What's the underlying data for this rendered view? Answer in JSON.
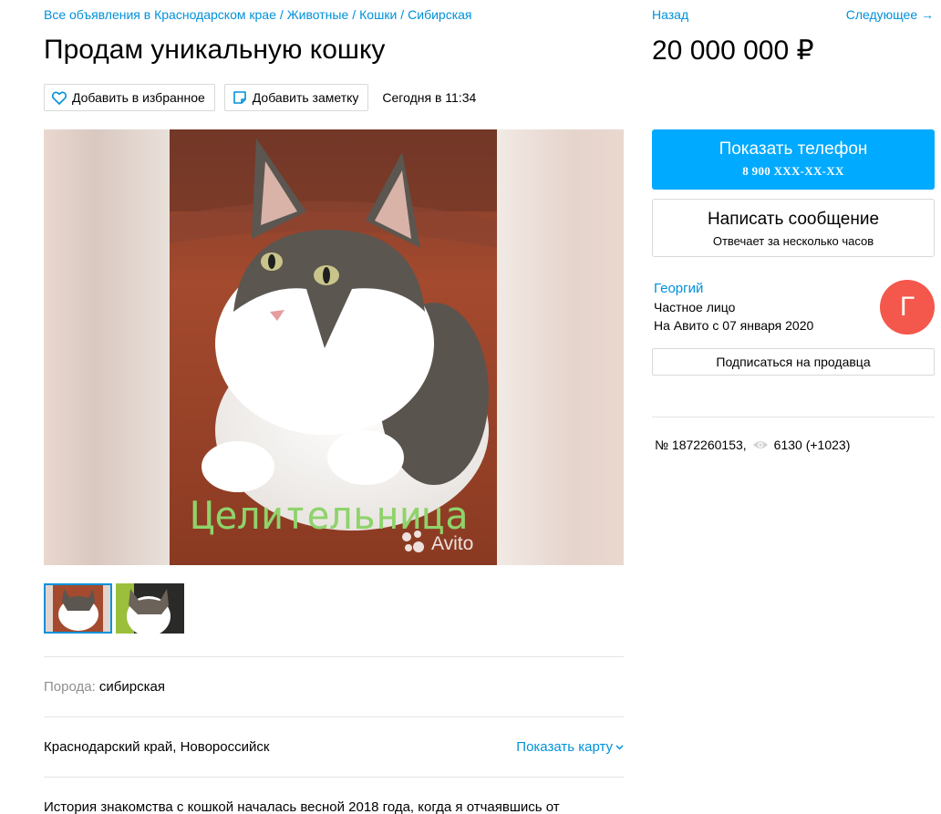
{
  "breadcrumbs": [
    "Все объявления в Краснодарском крае",
    "Животные",
    "Кошки",
    "Сибирская"
  ],
  "title": "Продам уникальную кошку",
  "actions": {
    "favorite_label": "Добавить в избранное",
    "note_label": "Добавить заметку",
    "date": "Сегодня в 11:34"
  },
  "gallery": {
    "overlay_text": "Целительница",
    "watermark": "Avito",
    "thumbnail_count": 2,
    "active_thumbnail": 1
  },
  "params": {
    "breed_key": "Порода:",
    "breed_value": "сибирская"
  },
  "location": {
    "address": "Краснодарский край, Новороссийск",
    "show_map": "Показать карту"
  },
  "description": "История знакомства с кошкой началась весной 2018 года, когда я отчаявшись от",
  "nav": {
    "back": "Назад",
    "next": "Следующее →"
  },
  "price": "20 000 000 ₽",
  "contact": {
    "phone_label": "Показать телефон",
    "phone_masked": "8 900 XXX-XX-XX",
    "message_label": "Написать сообщение",
    "message_sub": "Отвечает за несколько часов",
    "subscribe_label": "Подписаться на продавца"
  },
  "seller": {
    "name": "Георгий",
    "type": "Частное лицо",
    "since": "На Авито с 07 января 2020",
    "avatar_letter": "Г",
    "avatar_color": "#f4574b"
  },
  "meta": {
    "item_number": "№ 1872260153,",
    "views": "6130 (+1023)"
  },
  "colors": {
    "link": "#0091d9",
    "primary_button": "#00aaff"
  }
}
